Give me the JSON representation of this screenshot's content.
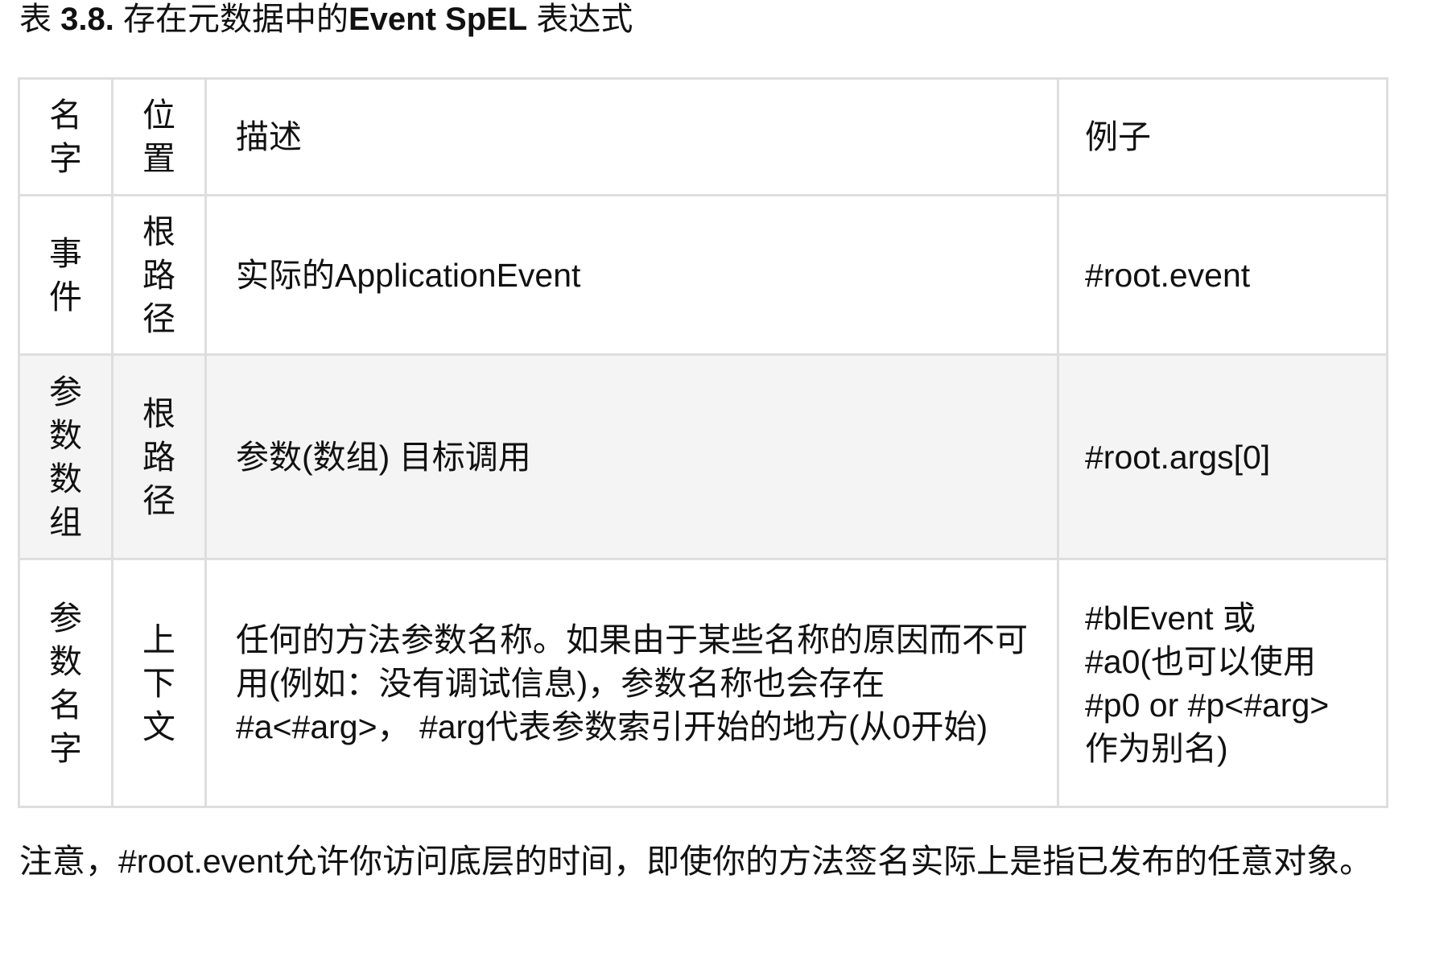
{
  "caption": {
    "prefix": "表 ",
    "number": "3.8.",
    "middle": " 存在元数据中的",
    "bold_title": "Event SpEL",
    "suffix": " 表达式"
  },
  "table": {
    "headers": {
      "name": "名字",
      "position": "位置",
      "description": "描述",
      "example": "例子"
    },
    "rows": [
      {
        "name": "事件",
        "position": "根路径",
        "description": "实际的ApplicationEvent",
        "example": "#root.event"
      },
      {
        "name": "参数数组",
        "position": "根路径",
        "description": "参数(数组) 目标调用",
        "example": "#root.args[0]"
      },
      {
        "name": "参数名字",
        "position": "上下文",
        "description": "任何的方法参数名称。如果由于某些名称的原因而不可用(例如：没有调试信息)，参数名称也会存在#a<#arg>， #arg代表参数索引开始的地方(从0开始)",
        "example": "#blEvent 或 #a0(也可以使用 #p0 or #p<#arg> 作为别名)"
      }
    ]
  },
  "note": "注意，#root.event允许你访问底层的时间，即使你的方法签名实际上是指已发布的任意对象。"
}
